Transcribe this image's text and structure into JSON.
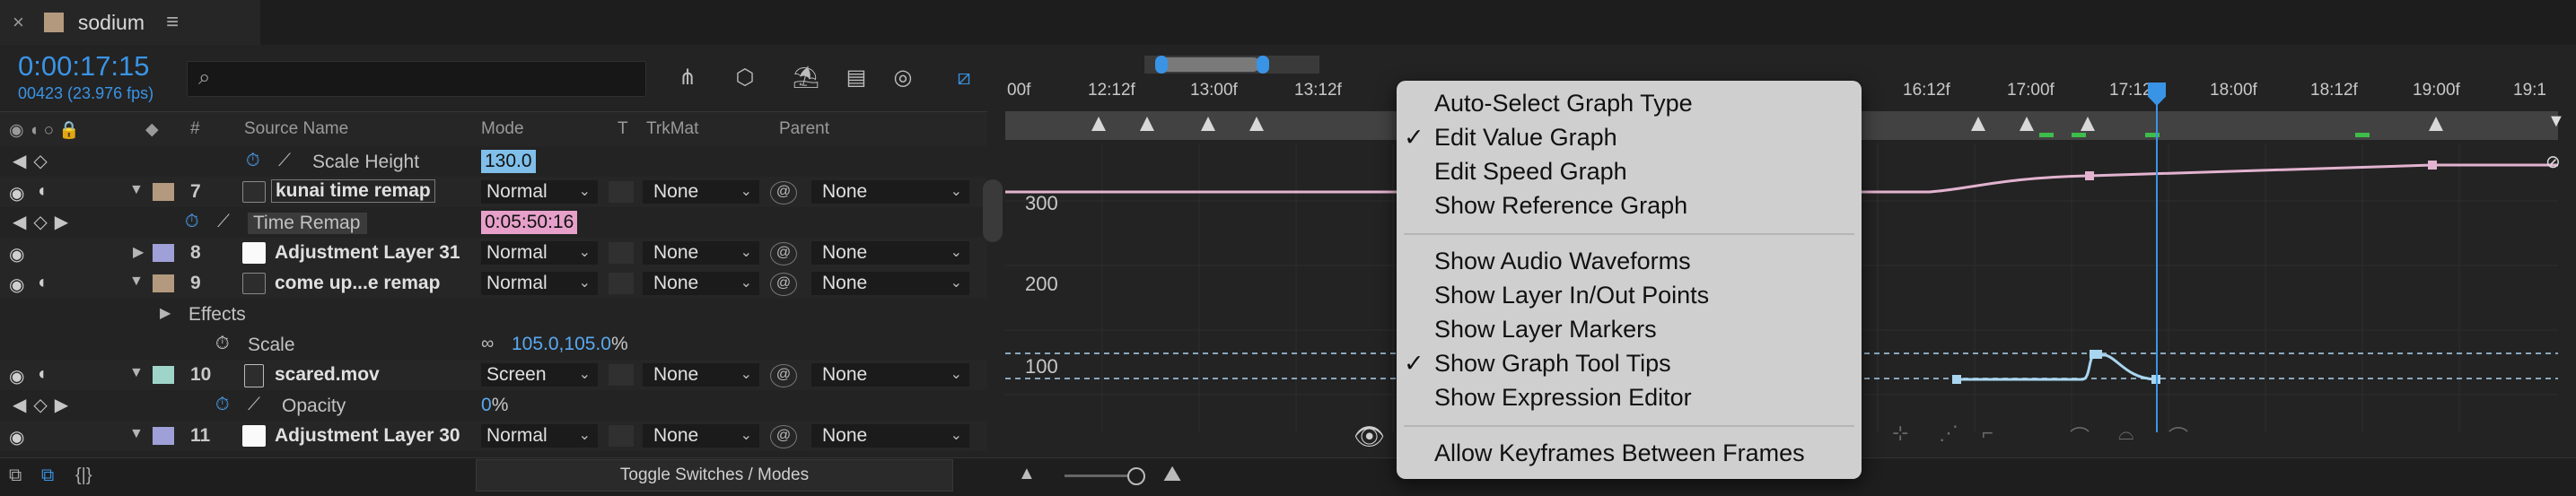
{
  "tab": {
    "title": "sodium"
  },
  "header": {
    "timecode": "0:00:17:15",
    "frames_fps": "00423 (23.976 fps)",
    "search_placeholder": ""
  },
  "columns": {
    "source_name": "Source Name",
    "mode": "Mode",
    "t": "T",
    "trkmat": "TrkMat",
    "parent": "Parent",
    "hash": "#"
  },
  "rows": [
    {
      "kind": "prop",
      "name": "Scale Height",
      "value": "130.0"
    },
    {
      "kind": "layer",
      "num": "7",
      "name": "kunai time remap",
      "mode": "Normal",
      "trkmat": "None",
      "parent": "None",
      "label_color": "#b39a7e"
    },
    {
      "kind": "prop",
      "name": "Time Remap",
      "value": "0:05:50:16"
    },
    {
      "kind": "layer",
      "num": "8",
      "name": "Adjustment Layer 31",
      "mode": "Normal",
      "trkmat": "None",
      "parent": "None",
      "label_color": "#a0a0d8"
    },
    {
      "kind": "layer",
      "num": "9",
      "name": "come up...e remap",
      "mode": "Normal",
      "trkmat": "None",
      "parent": "None",
      "label_color": "#b39a7e"
    },
    {
      "kind": "group",
      "name": "Effects"
    },
    {
      "kind": "prop",
      "name": "Scale",
      "value": "105.0,105.0",
      "unit": "%"
    },
    {
      "kind": "layer",
      "num": "10",
      "name": "scared.mov",
      "mode": "Screen",
      "trkmat": "None",
      "parent": "None",
      "label_color": "#9fd4c9"
    },
    {
      "kind": "prop",
      "name": "Opacity",
      "value": "0",
      "unit": "%"
    },
    {
      "kind": "layer",
      "num": "11",
      "name": "Adjustment Layer 30",
      "mode": "Normal",
      "trkmat": "None",
      "parent": "None",
      "label_color": "#a0a0d8"
    }
  ],
  "footer": {
    "toggle_label": "Toggle Switches / Modes"
  },
  "timeline": {
    "ruler_ticks": [
      "00f",
      "12:12f",
      "13:00f",
      "13:12f",
      "16:12f",
      "17:00f",
      "17:12f",
      "18:00f",
      "18:12f",
      "19:00f",
      "19:1"
    ],
    "y_labels": [
      "300",
      "200",
      "100"
    ]
  },
  "menu": {
    "items": [
      {
        "label": "Auto-Select Graph Type",
        "checked": false
      },
      {
        "label": "Edit Value Graph",
        "checked": true
      },
      {
        "label": "Edit Speed Graph",
        "checked": false
      },
      {
        "label": "Show Reference Graph",
        "checked": false
      },
      {
        "label": "Show Audio Waveforms",
        "checked": false
      },
      {
        "label": "Show Layer In/Out Points",
        "checked": false
      },
      {
        "label": "Show Layer Markers",
        "checked": false
      },
      {
        "label": "Show Graph Tool Tips",
        "checked": true
      },
      {
        "label": "Show Expression Editor",
        "checked": false
      },
      {
        "label": "Allow Keyframes Between Frames",
        "checked": false
      }
    ],
    "check_glyph": "✓"
  },
  "colors": {
    "accent": "#3a94e6",
    "keyframe_green": "#3dbd4a",
    "pink_curve": "#e3b3cf",
    "blue_curve": "#a9d6ee"
  }
}
